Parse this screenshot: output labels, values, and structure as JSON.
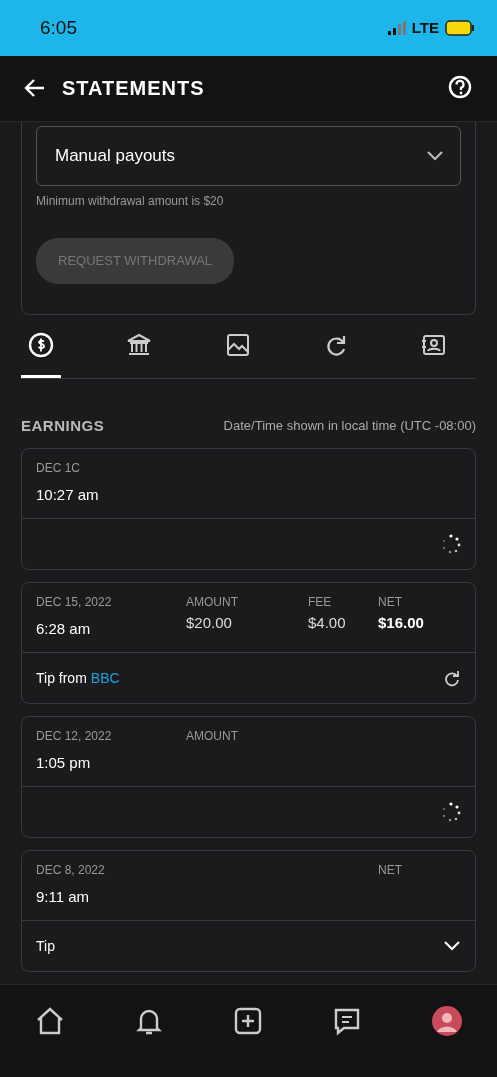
{
  "status_bar": {
    "time": "6:05",
    "network": "LTE"
  },
  "header": {
    "title": "STATEMENTS"
  },
  "payout": {
    "method": "Manual payouts",
    "note": "Minimum withdrawal amount is $20",
    "button": "REQUEST WITHDRAWAL",
    "button_disabled": true
  },
  "tabs": [
    {
      "selected": true
    },
    {
      "selected": false
    },
    {
      "selected": false
    },
    {
      "selected": false
    },
    {
      "selected": false
    }
  ],
  "earnings": {
    "title": "EARNINGS",
    "timezone_note": "Date/Time shown in local time (UTC -08:00)"
  },
  "transactions": [
    {
      "kind": "loading",
      "date": "DEC 1C",
      "time": "10:27 am"
    },
    {
      "kind": "tip",
      "date": "DEC 15, 2022",
      "time": "6:28 am",
      "amount_label": "AMOUNT",
      "amount": "$20.00",
      "fee_label": "FEE",
      "fee": "$4.00",
      "net_label": "NET",
      "net": "$16.00",
      "description": "Tip from",
      "user": "BBC"
    },
    {
      "kind": "loading",
      "date": "DEC 12, 2022",
      "time": "1:05 pm",
      "amount_label": "AMOUNT"
    },
    {
      "kind": "expandable",
      "date": "DEC 8, 2022",
      "time": "9:11 am",
      "net_label": "NET",
      "description": "Tip"
    }
  ]
}
